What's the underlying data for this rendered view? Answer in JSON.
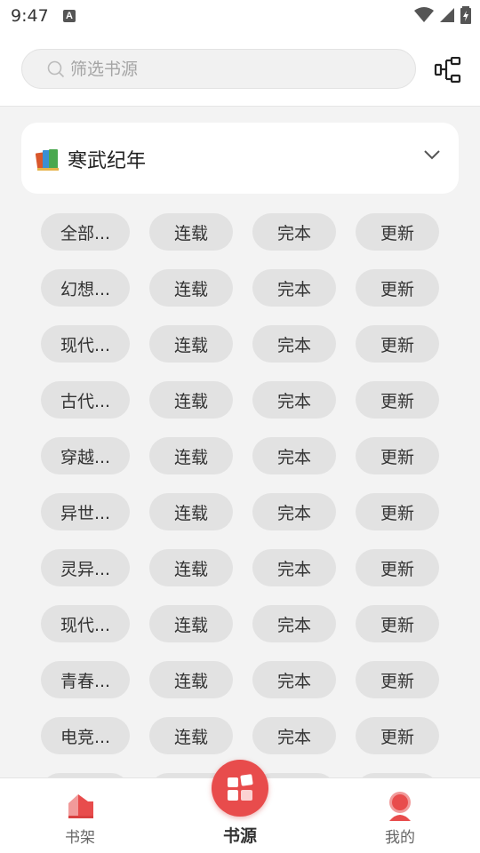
{
  "status_bar": {
    "time": "9:47",
    "badge": "A"
  },
  "search": {
    "placeholder": "筛选书源"
  },
  "source_card": {
    "title": "寒武纪年"
  },
  "category_rows": [
    {
      "category": "全部...",
      "tags": [
        "连载",
        "完本",
        "更新"
      ]
    },
    {
      "category": "幻想...",
      "tags": [
        "连载",
        "完本",
        "更新"
      ]
    },
    {
      "category": "现代...",
      "tags": [
        "连载",
        "完本",
        "更新"
      ]
    },
    {
      "category": "古代...",
      "tags": [
        "连载",
        "完本",
        "更新"
      ]
    },
    {
      "category": "穿越...",
      "tags": [
        "连载",
        "完本",
        "更新"
      ]
    },
    {
      "category": "异世...",
      "tags": [
        "连载",
        "完本",
        "更新"
      ]
    },
    {
      "category": "灵异...",
      "tags": [
        "连载",
        "完本",
        "更新"
      ]
    },
    {
      "category": "现代...",
      "tags": [
        "连载",
        "完本",
        "更新"
      ]
    },
    {
      "category": "青春...",
      "tags": [
        "连载",
        "完本",
        "更新"
      ]
    },
    {
      "category": "电竞...",
      "tags": [
        "连载",
        "完本",
        "更新"
      ]
    }
  ],
  "bottom_nav": {
    "shelf_label": "书架",
    "source_label": "书源",
    "mine_label": "我的"
  },
  "colors": {
    "accent": "#e84c4c",
    "chip_bg": "#e2e2e2",
    "page_bg": "#f3f3f3"
  }
}
